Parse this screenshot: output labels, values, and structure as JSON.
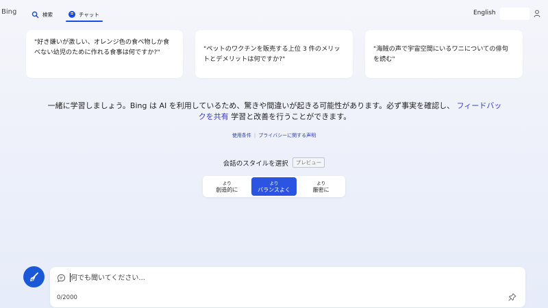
{
  "header": {
    "logo": "Bing",
    "tabs": [
      {
        "label": "検索",
        "icon": "search-icon"
      },
      {
        "label": "チャット",
        "icon": "chat-icon",
        "active": true
      }
    ],
    "language": "English"
  },
  "suggestions": [
    "\"好き嫌いが激しい、オレンジ色の食べ物しか食べない幼児のために作れる食事は何ですか?\"",
    "\"ペットのワクチンを販売する上位 3 件のメリットとデメリットは何ですか?\"",
    "\"海賊の声で宇宙空間にいるワニについての俳句を読む\""
  ],
  "disclaimer": {
    "text_before": "一緒に学習しましょう。Bing は AI を利用しているため、驚きや間違いが起きる可能性があります。必ず事実を確認し、",
    "link": "フィードバックを共有",
    "text_after": "学習と改善を行うことができます。"
  },
  "legal": {
    "terms": "使用条件",
    "privacy": "プライバシーに関する声明"
  },
  "conversation_style": {
    "title": "会話のスタイルを選択",
    "badge": "プレビュー",
    "options": [
      {
        "top": "より",
        "bottom": "創造的に"
      },
      {
        "top": "より",
        "bottom": "バランスよく",
        "active": true
      },
      {
        "top": "より",
        "bottom": "厳密に"
      }
    ]
  },
  "composer": {
    "placeholder": "何でも聞いてください...",
    "counter": "0/2000"
  },
  "colors": {
    "accent": "#174ae4",
    "active_tone": "#2b54e3",
    "link": "#3939cf"
  }
}
